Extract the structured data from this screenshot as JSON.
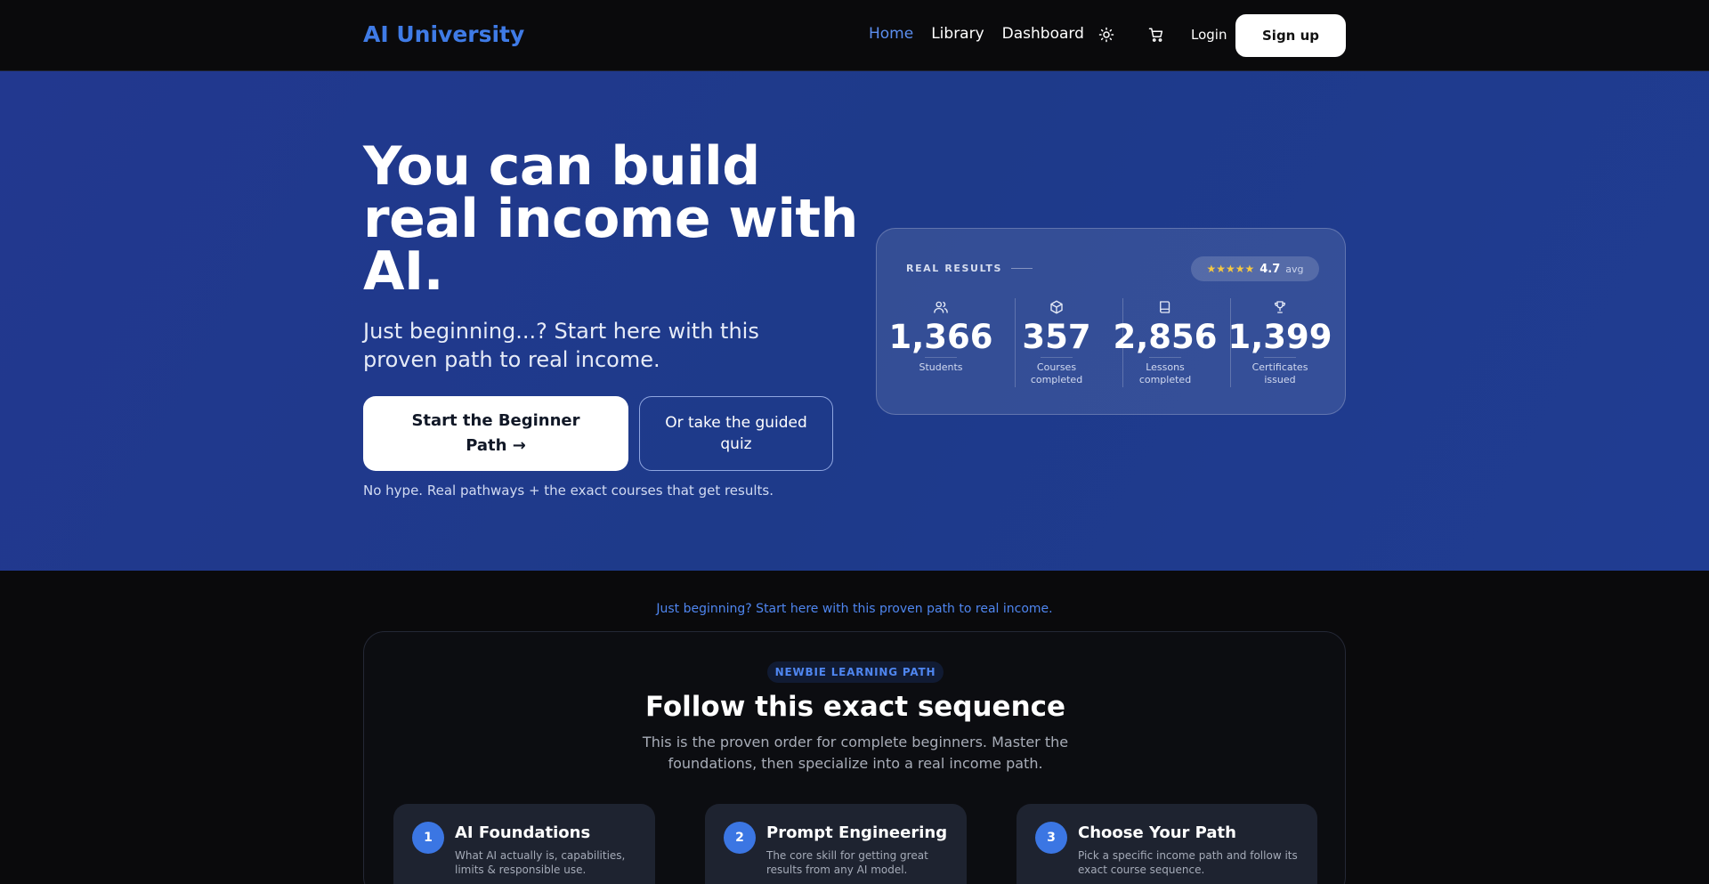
{
  "nav": {
    "brand": "AI University",
    "links": [
      "Home",
      "Library",
      "Dashboard"
    ],
    "active_link": "Home",
    "theme_icon": "sun-icon",
    "cart_icon": "cart-icon",
    "login": "Login",
    "signup": "Sign up"
  },
  "hero": {
    "title": "You can build real income with AI.",
    "subtitle": "Just beginning...? Start here with this proven path to real income.",
    "primary_cta": "Start the Beginner Path →",
    "secondary_cta": "Or take the guided quiz",
    "note": "No hype. Real pathways + the exact courses that get results."
  },
  "results": {
    "label": "REAL RESULTS",
    "stars": "★★★★★",
    "rating": "4.7",
    "rating_suffix": "avg",
    "stats": [
      {
        "icon": "users-icon",
        "value": "1,366",
        "label": "Students"
      },
      {
        "icon": "box-icon",
        "value": "357",
        "label": "Courses completed"
      },
      {
        "icon": "book-icon",
        "value": "2,856",
        "label": "Lessons completed"
      },
      {
        "icon": "trophy-icon",
        "value": "1,399",
        "label": "Certificates issued"
      }
    ]
  },
  "path": {
    "tagline": "Just beginning? Start here with this proven path to real income.",
    "badge": "NEWBIE LEARNING PATH",
    "title": "Follow this exact sequence",
    "description": "This is the proven order for complete beginners. Master the foundations, then specialize into a real income path.",
    "steps": [
      {
        "num": "1",
        "title": "AI Foundations",
        "desc": "What AI actually is, capabilities, limits & responsible use."
      },
      {
        "num": "2",
        "title": "Prompt Engineering",
        "desc": "The core skill for getting great results from any AI model."
      },
      {
        "num": "3",
        "title": "Choose Your Path",
        "desc": "Pick a specific income path and follow its exact course sequence."
      }
    ]
  },
  "colors": {
    "accent": "#3f7be6",
    "hero_bg": "#1e3a8a",
    "page_bg": "#0a0a0c",
    "star": "#f5c842"
  }
}
